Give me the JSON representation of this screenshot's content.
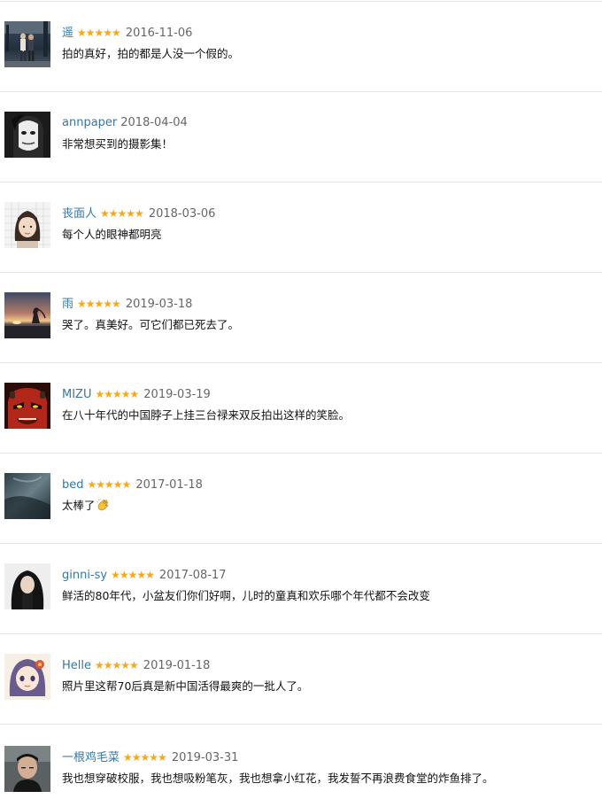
{
  "star_color": "#f4a81d",
  "link_color": "#3377aa",
  "comments": [
    {
      "user": "遥",
      "stars": "★★★★★",
      "rating": 5,
      "date": "2016-11-06",
      "text": "拍的真好，拍的都是人没一个假的。",
      "avatar_icon": "couple-walking-avatar"
    },
    {
      "user": "annpaper",
      "stars": "",
      "rating": 0,
      "date": "2018-04-04",
      "text": "非常想买到的摄影集！",
      "avatar_icon": "masked-face-avatar"
    },
    {
      "user": "丧面人",
      "stars": "★★★★★",
      "rating": 5,
      "date": "2018-03-06",
      "text": "每个人的眼神都明亮",
      "avatar_icon": "girl-portrait-avatar"
    },
    {
      "user": "雨",
      "stars": "★★★★★",
      "rating": 5,
      "date": "2019-03-18",
      "text": "哭了。真美好。可它们都已死去了。",
      "avatar_icon": "sunset-silhouette-avatar"
    },
    {
      "user": "MIZU",
      "stars": "★★★★★",
      "rating": 5,
      "date": "2019-03-19",
      "text": "在八十年代的中国脖子上挂三台禄来双反拍出这样的笑脸。",
      "avatar_icon": "red-demon-avatar"
    },
    {
      "user": "bed",
      "stars": "★★★★★",
      "rating": 5,
      "date": "2017-01-18",
      "text": "太棒了",
      "avatar_icon": "dark-teal-avatar",
      "emoji": "clapping-hands-icon"
    },
    {
      "user": "ginni-sy",
      "stars": "★★★★★",
      "rating": 5,
      "date": "2017-08-17",
      "text": "鲜活的80年代，小盆友们你们好啊，儿时的童真和欢乐哪个年代都不会改变",
      "avatar_icon": "dark-hair-girl-avatar"
    },
    {
      "user": "Helle",
      "stars": "★★★★★",
      "rating": 5,
      "date": "2019-01-18",
      "text": "照片里这帮70后真是新中国活得最爽的一批人了。",
      "avatar_icon": "anime-girl-avatar"
    },
    {
      "user": "一根鸡毛菜",
      "stars": "★★★★★",
      "rating": 5,
      "date": "2019-03-31",
      "text": "我也想穿破校服，我也想吸粉笔灰，我也想拿小红花，我发誓不再浪费食堂的炸鱼排了。",
      "avatar_icon": "young-man-avatar"
    }
  ]
}
